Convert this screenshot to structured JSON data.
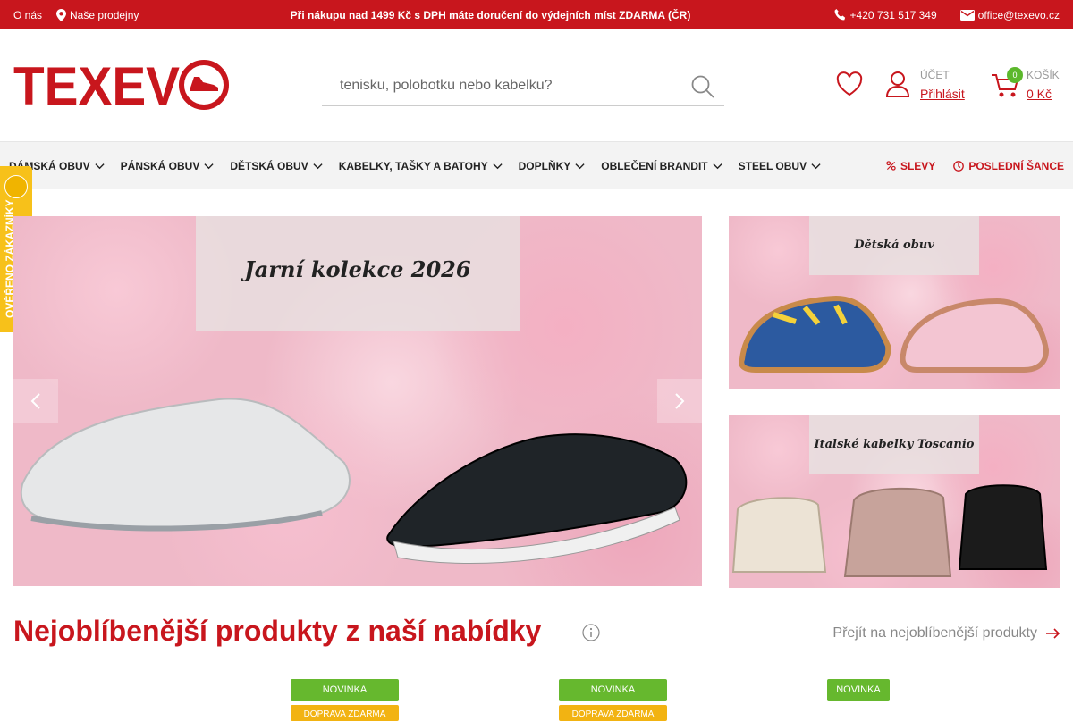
{
  "topbar": {
    "about": "O nás",
    "stores": "Naše prodejny",
    "promo": "Při nákupu nad 1499 Kč s DPH máte doručení do výdejních míst ZDARMA (ČR)",
    "phone": "+420 731 517 349",
    "email": "office@texevo.cz"
  },
  "brand": {
    "logo": "TEXEVO",
    "accent": "#c8161d"
  },
  "search": {
    "placeholder": "tenisku, polobotku nebo kabelku?"
  },
  "account": {
    "title": "ÚČET",
    "login": "Přihlásit"
  },
  "cart": {
    "title": "KOŠÍK",
    "count": "0",
    "price": "0 Kč"
  },
  "nav": {
    "items": [
      {
        "label": "DÁMSKÁ OBUV"
      },
      {
        "label": "PÁNSKÁ OBUV"
      },
      {
        "label": "DĚTSKÁ OBUV"
      },
      {
        "label": "KABELKY, TAŠKY A BATOHY"
      },
      {
        "label": "DOPLŇKY"
      },
      {
        "label": "OBLEČENÍ BRANDIT"
      },
      {
        "label": "STEEL OBUV"
      }
    ],
    "sale": "SLEVY",
    "last_chance": "POSLEDNÍ ŠANCE"
  },
  "verified": {
    "label": "OVĚŘENO ZÁKAZNÍKY"
  },
  "hero": {
    "title": "Jarní kolekce 2026"
  },
  "banners": [
    {
      "title": "Dětská obuv"
    },
    {
      "title": "Italské kabelky Toscanio"
    }
  ],
  "section": {
    "title": "Nejoblíbenější produkty z naší nabídky",
    "see_all": "Přejít na nejoblíbenější produkty"
  },
  "product_tags": [
    {
      "new": "NOVINKA",
      "delivery": "DOPRAVA ZDARMA"
    },
    {
      "new": "NOVINKA",
      "delivery": "DOPRAVA ZDARMA"
    },
    {
      "new": "NOVINKA"
    }
  ]
}
